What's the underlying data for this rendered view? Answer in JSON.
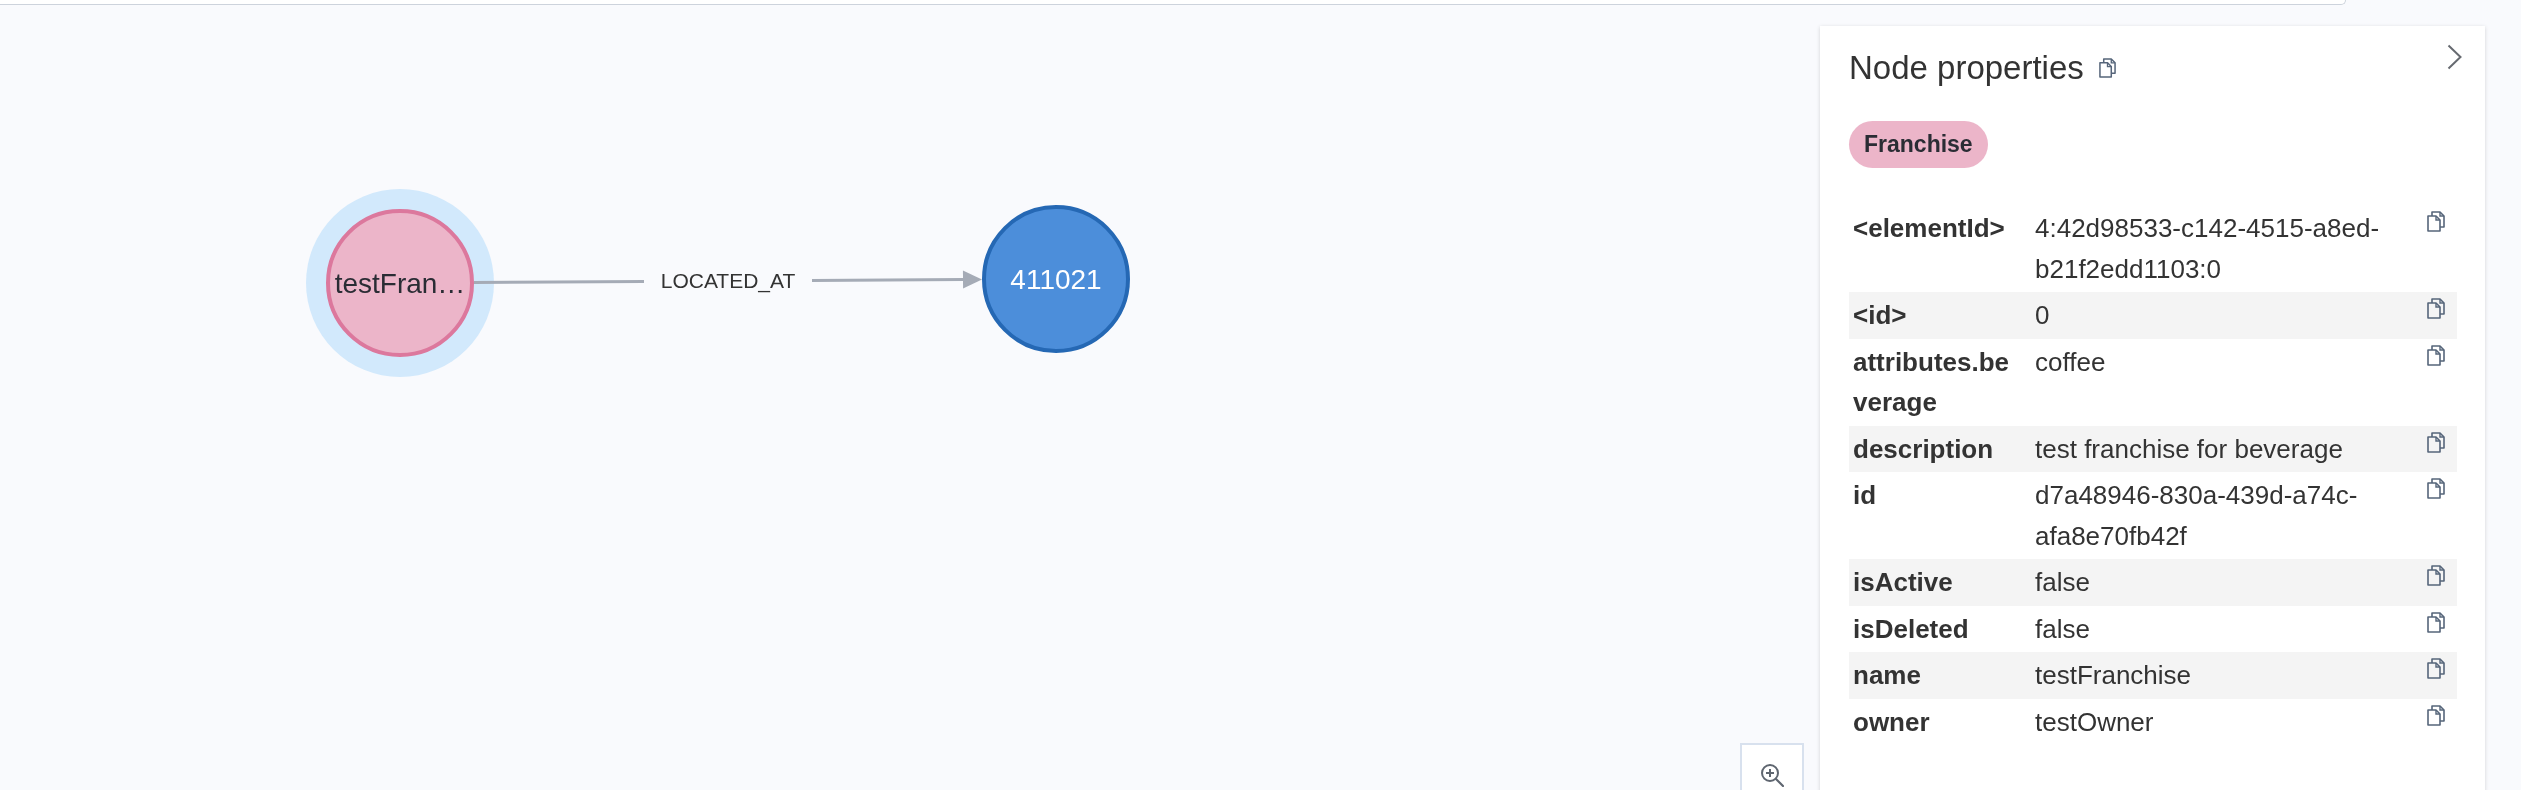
{
  "graph": {
    "nodes": [
      {
        "caption": "testFran…",
        "color": "#ecb5c9",
        "selected": true
      },
      {
        "caption": "411021",
        "color": "#4c8eda",
        "selected": false
      }
    ],
    "relationships": [
      {
        "type": "LOCATED_AT"
      }
    ]
  },
  "properties_panel": {
    "title": "Node properties",
    "labels": [
      {
        "text": "Franchise",
        "color": "#ecb5c9"
      }
    ],
    "properties": [
      {
        "key": "<elementId>",
        "value": "4:42d98533-c142-4515-a8ed-b21f2edd1103:0"
      },
      {
        "key": "<id>",
        "value": "0"
      },
      {
        "key": "attributes.beverage",
        "value": "coffee"
      },
      {
        "key": "description",
        "value": "test franchise for beverage"
      },
      {
        "key": "id",
        "value": "d7a48946-830a-439d-a74c-afa8e70fb42f"
      },
      {
        "key": "isActive",
        "value": "false"
      },
      {
        "key": "isDeleted",
        "value": "false"
      },
      {
        "key": "name",
        "value": "testFranchise"
      },
      {
        "key": "owner",
        "value": "testOwner"
      }
    ]
  }
}
